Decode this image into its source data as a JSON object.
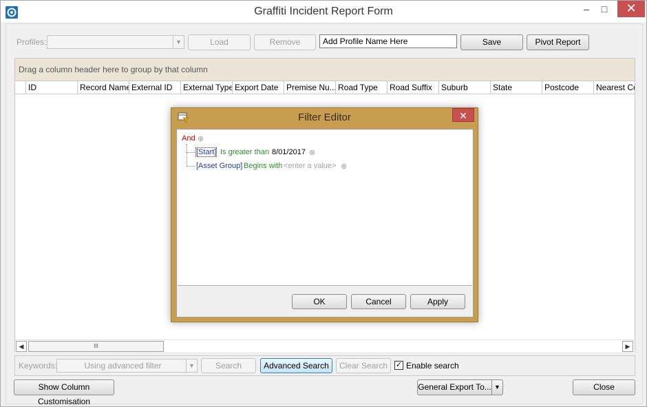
{
  "window": {
    "title": "Graffiti Incident Report Form",
    "minimize": "‒",
    "maximize": "□",
    "close": "✕"
  },
  "profiles": {
    "label": "Profiles:",
    "value": "",
    "load": "Load",
    "remove": "Remove",
    "name_input": "Add Profile Name Here",
    "save": "Save",
    "pivot": "Pivot Report"
  },
  "grid": {
    "group_hint": "Drag a column header here to group by that column",
    "columns": [
      "ID",
      "Record Name",
      "External ID",
      "External Type",
      "Export Date",
      "Premise Nu...",
      "Road Type",
      "Road Suffix",
      "Suburb",
      "State",
      "Postcode",
      "Nearest Co"
    ],
    "scroll_thumb_grip": "III"
  },
  "search": {
    "keywords_label": "Keywords:",
    "keywords_value": "Using advanced filter",
    "search": "Search",
    "advanced_search": "Advanced Search",
    "clear_search": "Clear Search",
    "enable_search": "Enable search",
    "enable_checked": "✓"
  },
  "footer": {
    "show_customisation": "Show Column Customisation",
    "export": "General Export To...",
    "close": "Close"
  },
  "filter_editor": {
    "title": "Filter Editor",
    "close": "✕",
    "group_operator": "And",
    "conditions": [
      {
        "field": "[Start]",
        "operator": "Is greater than",
        "value": "8/01/2017"
      },
      {
        "field": "[Asset Group]",
        "operator": "Begins with",
        "value": "<enter a value>"
      }
    ],
    "ok": "OK",
    "cancel": "Cancel",
    "apply": "Apply"
  },
  "colors": {
    "dialog_frame": "#c79d50",
    "group_panel": "#ebe5d8",
    "close_red": "#c75050"
  }
}
